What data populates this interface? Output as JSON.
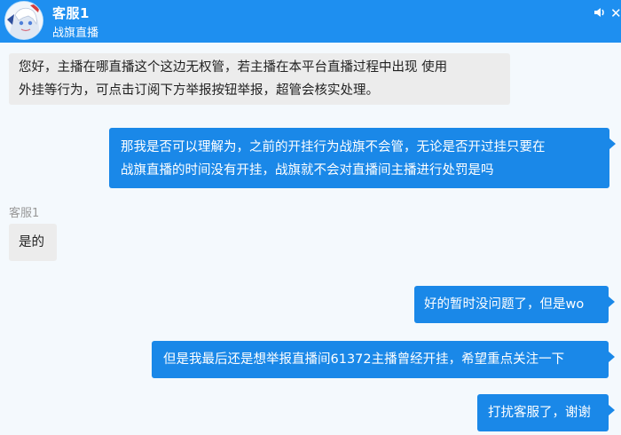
{
  "header": {
    "title": "客服1",
    "subtitle": "战旗直播",
    "volume_icon": "speaker-icon",
    "close_icon": "close-icon",
    "bg_color": "#1e8ff0"
  },
  "messages": [
    {
      "side": "left",
      "lines": [
        "您好，主播在哪直播这个这边无权管，若主播在本平台直播过程中出现 使用",
        "外挂等行为，可点击订阅下方举报按钮举报，超管会核实处理。"
      ]
    },
    {
      "side": "right",
      "lines": [
        "那我是否可以理解为，之前的开挂行为战旗不会管，无论是否开过挂只要在",
        "战旗直播的时间没有开挂，战旗就不会对直播间主播进行处罚是吗"
      ]
    },
    {
      "side": "left",
      "sender": "客服1",
      "lines": [
        "是的"
      ]
    },
    {
      "side": "right",
      "lines": [
        "好的暂时没问题了，但是wo"
      ]
    },
    {
      "side": "right",
      "lines": [
        "但是我最后还是想举报直播间61372主播曾经开挂，希望重点关注一下"
      ]
    },
    {
      "side": "right",
      "lines": [
        "打扰客服了，谢谢"
      ]
    }
  ]
}
